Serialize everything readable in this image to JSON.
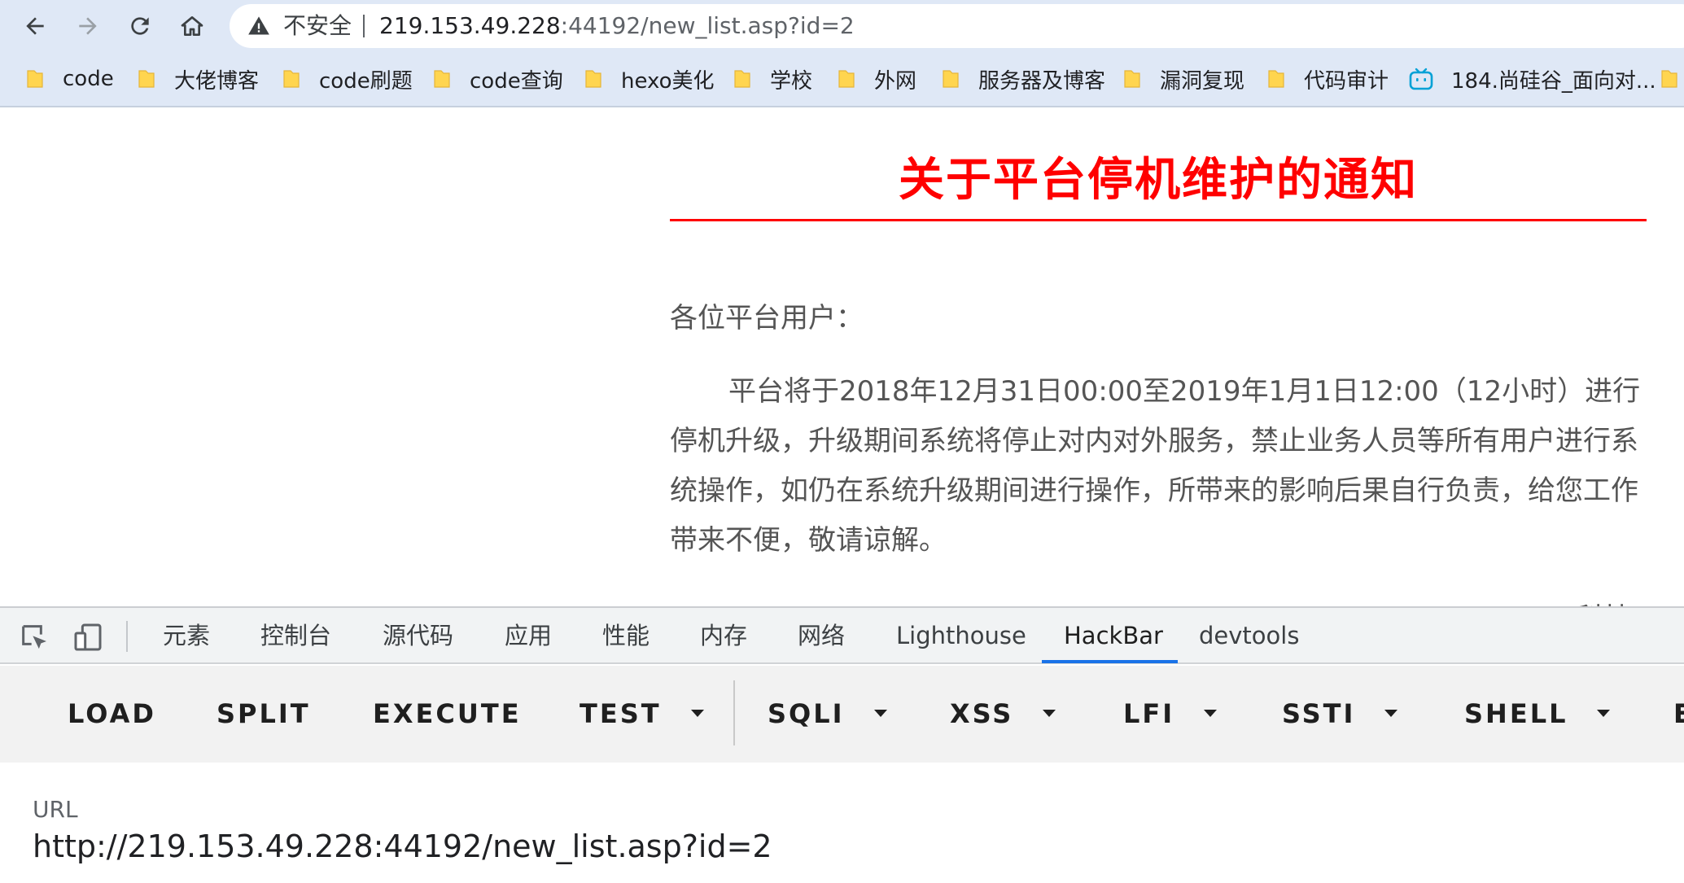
{
  "browser": {
    "security_label": "不安全",
    "url_host": "219.153.49.228",
    "url_rest": ":44192/new_list.asp?id=2"
  },
  "bookmarks": [
    {
      "label": "code",
      "icon": "folder-icon"
    },
    {
      "label": "大佬博客",
      "icon": "folder-icon"
    },
    {
      "label": "code刷题",
      "icon": "folder-icon"
    },
    {
      "label": "code查询",
      "icon": "folder-icon"
    },
    {
      "label": "hexo美化",
      "icon": "folder-icon"
    },
    {
      "label": "学校",
      "icon": "folder-icon"
    },
    {
      "label": "外网",
      "icon": "folder-icon"
    },
    {
      "label": "服务器及博客",
      "icon": "folder-icon"
    },
    {
      "label": "漏洞复现",
      "icon": "folder-icon"
    },
    {
      "label": "代码审计",
      "icon": "folder-icon"
    },
    {
      "label": "184.尚硅谷_面向对...",
      "icon": "bilibili-icon"
    }
  ],
  "page": {
    "title": "关于平台停机维护的通知",
    "greeting": "各位平台用户：",
    "body": "平台将于2018年12月31日00:00至2019年1月1日12:00（12小时）进行停机升级，升级期间系统将停止对内对外服务，禁止业务人员等所有用户进行系统操作，如仍在系统升级期间进行操作，所带来的影响后果自行负责，给您工作带来不便，敬请谅解。",
    "signature": "XWAY科技"
  },
  "devtools": {
    "tabs": [
      "元素",
      "控制台",
      "源代码",
      "应用",
      "性能",
      "内存",
      "网络",
      "Lighthouse",
      "HackBar",
      "devtools"
    ],
    "active_tab": "HackBar",
    "accent_color": "#1a73e8"
  },
  "hackbar": {
    "buttons": [
      {
        "label": "LOAD",
        "dropdown": false
      },
      {
        "label": "SPLIT",
        "dropdown": false
      },
      {
        "label": "EXECUTE",
        "dropdown": false
      },
      {
        "label": "TEST",
        "dropdown": true
      },
      {
        "label": "SQLI",
        "dropdown": true
      },
      {
        "label": "XSS",
        "dropdown": true
      },
      {
        "label": "LFI",
        "dropdown": true
      },
      {
        "label": "SSTI",
        "dropdown": true
      },
      {
        "label": "SHELL",
        "dropdown": true
      },
      {
        "label": "E",
        "dropdown": false
      }
    ],
    "url_label": "URL",
    "url_value": "http://219.153.49.228:44192/new_list.asp?id=2"
  }
}
